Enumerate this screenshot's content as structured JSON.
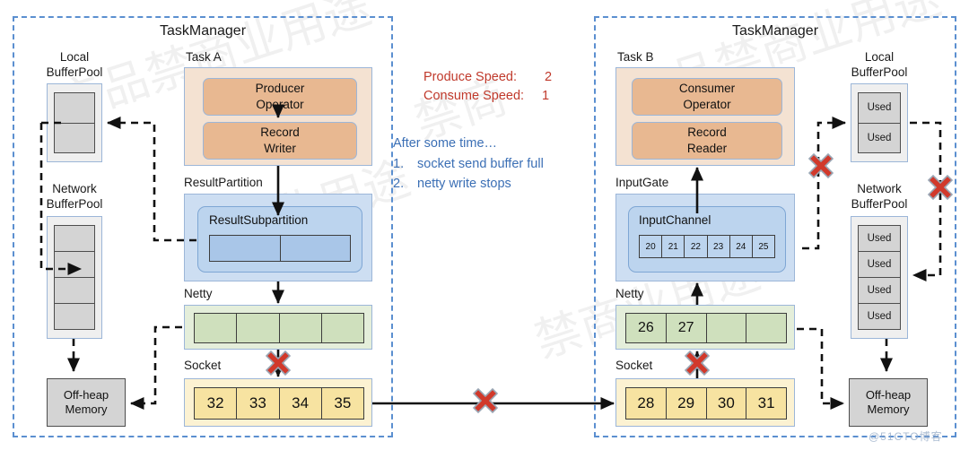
{
  "diagram": {
    "title": "Flink network stack backpressure diagram",
    "watermark": "@51CTO博客",
    "watermark_cn": "产品禁商业用途"
  },
  "colors": {
    "task_fill": "#f4e2d2",
    "operator_fill": "#e8b891",
    "partition_fill": "#cddef2",
    "subpartition_fill": "#a9c6e8",
    "netty_fill": "#cfe0bd",
    "socket_fill": "#f7e3a1",
    "pool_fill": "#d4d4d4",
    "container_border": "#5b8fd0",
    "blocked_marker": "#d1392b",
    "speed_text": "#c0392b",
    "note_text": "#3b6fb5"
  },
  "left": {
    "title": "TaskManager",
    "local_pool": {
      "label_line1": "Local",
      "label_line2": "BufferPool",
      "cells": [
        "",
        ""
      ]
    },
    "network_pool": {
      "label_line1": "Network",
      "label_line2": "BufferPool",
      "cells": [
        "",
        "",
        "",
        ""
      ]
    },
    "offheap": {
      "line1": "Off-heap",
      "line2": "Memory"
    },
    "task": {
      "caption": "Task A",
      "operator": {
        "line1": "Producer",
        "line2": "Operator"
      },
      "record": {
        "line1": "Record",
        "line2": "Writer"
      }
    },
    "result_partition": {
      "caption": "ResultPartition",
      "subpartition_label": "ResultSubpartition",
      "cells": [
        "",
        ""
      ]
    },
    "netty": {
      "caption": "Netty",
      "cells": [
        "",
        "",
        "",
        ""
      ]
    },
    "socket": {
      "caption": "Socket",
      "cells": [
        "32",
        "33",
        "34",
        "35"
      ]
    }
  },
  "right": {
    "title": "TaskManager",
    "local_pool": {
      "label_line1": "Local",
      "label_line2": "BufferPool",
      "cells": [
        "Used",
        "Used"
      ]
    },
    "network_pool": {
      "label_line1": "Network",
      "label_line2": "BufferPool",
      "cells": [
        "Used",
        "Used",
        "Used",
        "Used"
      ]
    },
    "offheap": {
      "line1": "Off-heap",
      "line2": "Memory"
    },
    "task": {
      "caption": "Task B",
      "operator": {
        "line1": "Consumer",
        "line2": "Operator"
      },
      "record": {
        "line1": "Record",
        "line2": "Reader"
      }
    },
    "input_gate": {
      "caption": "InputGate",
      "channel_label": "InputChannel",
      "cells": [
        "20",
        "21",
        "22",
        "23",
        "24",
        "25"
      ]
    },
    "netty": {
      "caption": "Netty",
      "cells": [
        "26",
        "27",
        "",
        ""
      ]
    },
    "socket": {
      "caption": "Socket",
      "cells": [
        "28",
        "29",
        "30",
        "31"
      ]
    }
  },
  "annotations": {
    "produce_speed_label": "Produce Speed:",
    "produce_speed_value": "2",
    "consume_speed_label": "Consume Speed:",
    "consume_speed_value": "1",
    "note_heading": "After some time…",
    "note_item_1_num": "1.",
    "note_item_1": "socket send buffer full",
    "note_item_2_num": "2.",
    "note_item_2": "netty write stops"
  }
}
